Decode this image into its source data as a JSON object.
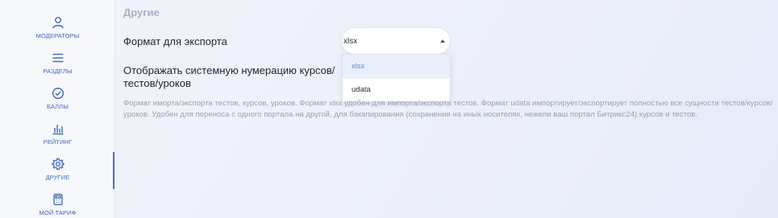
{
  "sidebar": {
    "items": [
      {
        "label": "МОДЕРАТОРЫ",
        "icon": "user-icon"
      },
      {
        "label": "РАЗДЕЛЫ",
        "icon": "menu-icon"
      },
      {
        "label": "БАЛЛЫ",
        "icon": "check-circle-icon"
      },
      {
        "label": "РЕЙТИНГ",
        "icon": "bar-chart-icon"
      },
      {
        "label": "ДРУГИЕ",
        "icon": "gear-icon",
        "active": true
      },
      {
        "label": "МОЙ ТАРИФ",
        "icon": "calculator-icon"
      }
    ],
    "accent_color": "#3a67b9"
  },
  "main": {
    "section_title": "Другие",
    "export_format": {
      "label": "Формат для экспорта",
      "selected": "xlsx",
      "options": [
        "xlsx",
        "udata"
      ]
    },
    "numbering": {
      "label_line1": "Отображать системную нумерацию курсов/",
      "label_line2": "тестов/уроков"
    },
    "description": "Формат иморта/экспорта тестов, курсов, уроков. Формат xlsx удобен для импорта/экспорта тестов. Формат udata импортирует/экспортирует полностью все сущности тестов/курсов/уроков. Удобен для переноса с одного портала на другой, для бэкапирования (сохранения на иных носителях, нежели ваш портал Битрикс24) курсов и тестов."
  }
}
